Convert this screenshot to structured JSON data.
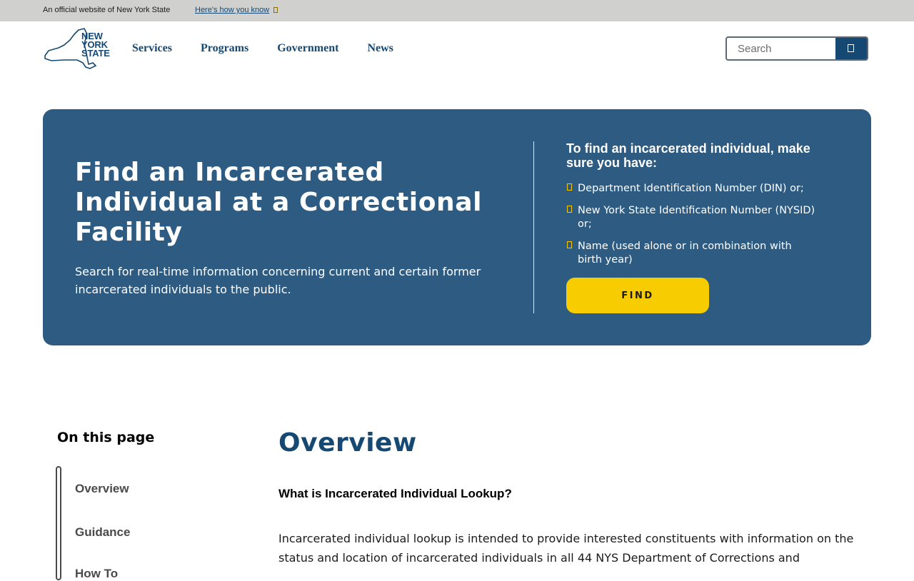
{
  "official_banner": {
    "text": "An official website of New York State",
    "link_label": "Here's how you know",
    "link_icon": "chevron-down-icon"
  },
  "header": {
    "logo": {
      "line1": "NEW",
      "line2": "YORK",
      "line3": "STATE",
      "icon": "new-york-state-map-icon"
    },
    "nav": [
      "Services",
      "Programs",
      "Government",
      "News"
    ],
    "search": {
      "placeholder": "Search",
      "button_icon": "search-icon"
    }
  },
  "hero": {
    "title": "Find an Incarcerated Individual at a Correctional Facility",
    "description": "Search for real-time information concerning current and certain former incarcerated individuals to the public.",
    "requirements_heading": "To find an incarcerated individual, make sure you have:",
    "requirements": [
      "Department Identification Number (DIN) or;",
      "New York State Identification Number (NYSID) or;",
      "Name (used alone or in combination with birth year)"
    ],
    "button_label": "FIND"
  },
  "on_this_page": {
    "title": "On this page",
    "links": [
      "Overview",
      "Guidance",
      "How To"
    ]
  },
  "content": {
    "title": "Overview",
    "question": "What is Incarcerated Individual Lookup?",
    "body": "Incarcerated individual lookup is intended to provide interested constituents with information on the status and location of incarcerated individuals in all 44 NYS Department of Corrections and"
  },
  "colors": {
    "brand_blue": "#154973",
    "hero_blue": "#2d5b82",
    "accent_yellow": "#f7cd02",
    "banner_gray": "#d0d0ce"
  }
}
